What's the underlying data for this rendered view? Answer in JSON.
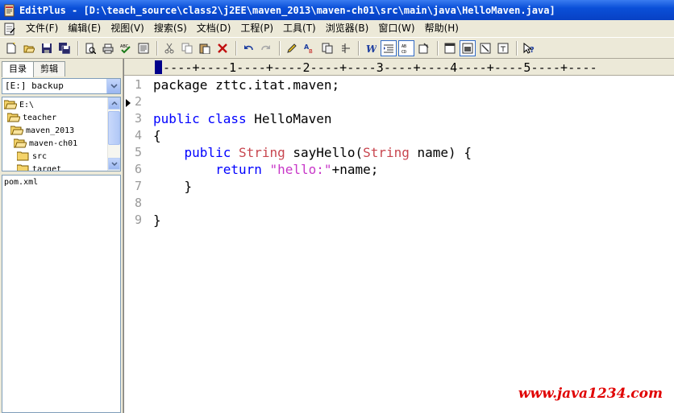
{
  "window": {
    "title": "EditPlus - [D:\\teach_source\\class2\\j2EE\\maven_2013\\maven-ch01\\src\\main\\java\\HelloMaven.java]"
  },
  "menu": [
    {
      "label": "文件(F)"
    },
    {
      "label": "编辑(E)"
    },
    {
      "label": "视图(V)"
    },
    {
      "label": "搜索(S)"
    },
    {
      "label": "文档(D)"
    },
    {
      "label": "工程(P)"
    },
    {
      "label": "工具(T)"
    },
    {
      "label": "浏览器(B)"
    },
    {
      "label": "窗口(W)"
    },
    {
      "label": "帮助(H)"
    }
  ],
  "toolbar": {
    "icons": [
      "new-icon",
      "open-icon",
      "save-icon",
      "save-all-icon",
      "print-preview-icon",
      "print-icon",
      "spell-check-icon",
      "browser-icon",
      "cut-icon",
      "copy-icon",
      "paste-icon",
      "delete-icon",
      "undo-icon",
      "redo-icon",
      "highlight-icon",
      "find-replace-icon",
      "replace-icon",
      "goto-line-icon",
      "bold-italic-icon",
      "indent-icon",
      "wordwrap-icon",
      "settings-icon",
      "window-icon",
      "window2-icon",
      "window3-icon",
      "window4-icon",
      "help-icon"
    ]
  },
  "sidebar": {
    "tabs": [
      {
        "label": "目录"
      },
      {
        "label": "剪辑"
      }
    ],
    "drive": "[E:] backup",
    "tree": [
      {
        "label": "E:\\",
        "level": 0
      },
      {
        "label": "teacher",
        "level": 1
      },
      {
        "label": "maven_2013",
        "level": 2
      },
      {
        "label": "maven-ch01",
        "level": 3
      },
      {
        "label": "src",
        "level": 4
      },
      {
        "label": "target",
        "level": 4
      }
    ],
    "files": [
      "pom.xml"
    ]
  },
  "ruler": {
    "text": "----+----1----+----2----+----3----+----4----+----5----+----"
  },
  "editor": {
    "line_numbers": [
      "1",
      "2",
      "3",
      "4",
      "5",
      "6",
      "7",
      "8",
      "9"
    ],
    "lines": [
      {
        "parts": [
          {
            "t": "package zttc.itat.maven;",
            "c": "pl"
          }
        ]
      },
      {
        "parts": []
      },
      {
        "parts": [
          {
            "t": "public class ",
            "c": "kw"
          },
          {
            "t": "HelloMaven",
            "c": "pl"
          }
        ]
      },
      {
        "parts": [
          {
            "t": "{",
            "c": "pl"
          }
        ]
      },
      {
        "parts": [
          {
            "t": "    public ",
            "c": "kw"
          },
          {
            "t": "String",
            "c": "ty"
          },
          {
            "t": " sayHello(",
            "c": "pl"
          },
          {
            "t": "String",
            "c": "ty"
          },
          {
            "t": " name) {",
            "c": "pl"
          }
        ]
      },
      {
        "parts": [
          {
            "t": "        return ",
            "c": "kw"
          },
          {
            "t": "\"hello:\"",
            "c": "st"
          },
          {
            "t": "+name;",
            "c": "pl"
          }
        ]
      },
      {
        "parts": [
          {
            "t": "    }",
            "c": "pl"
          }
        ]
      },
      {
        "parts": []
      },
      {
        "parts": [
          {
            "t": "}",
            "c": "pl"
          }
        ]
      }
    ],
    "current_line": "2"
  },
  "watermark": "www.java1234.com",
  "colors": {
    "titlebar": "#0a4fd8",
    "keyword": "#0000ff",
    "type": "#c8464f",
    "string": "#c837c8",
    "line_number": "#9a9a9a",
    "watermark": "#e00000"
  }
}
